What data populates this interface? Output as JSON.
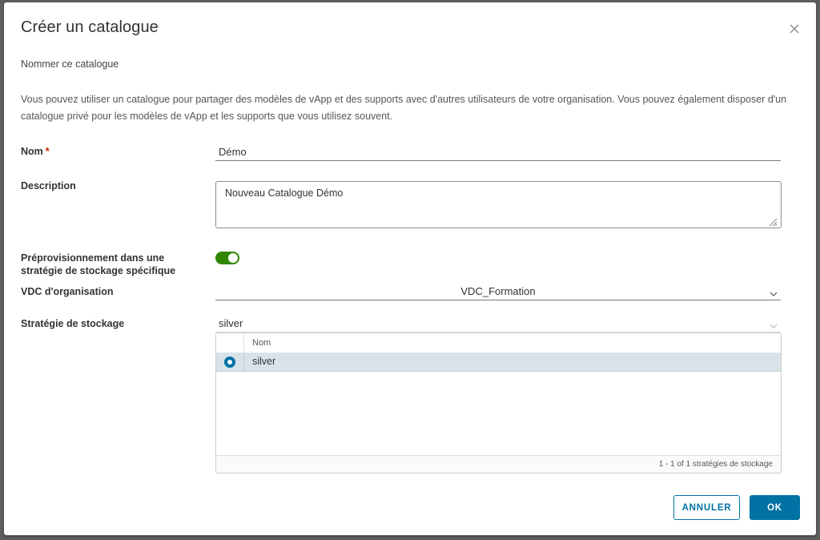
{
  "dialog": {
    "title": "Créer un catalogue",
    "subtitle": "Nommer ce catalogue",
    "intro": "Vous pouvez utiliser un catalogue pour partager des modèles de vApp et des supports avec d'autres utilisateurs de votre organisation. Vous pouvez également disposer d'un catalogue privé pour les modèles de vApp et les supports que vous utilisez souvent."
  },
  "form": {
    "name_label": "Nom",
    "name_required": "*",
    "name_value": "Démo",
    "description_label": "Description",
    "description_value": "Nouveau Catalogue Démo",
    "preprov_label": "Préprovisionnement dans une stratégie de stockage spécifique",
    "preprov_enabled": true,
    "vdc_label": "VDC d'organisation",
    "vdc_value": "VDC_Formation",
    "storage_label": "Stratégie de stockage",
    "storage_value": "silver"
  },
  "grid": {
    "column_header": "Nom",
    "rows": [
      {
        "name": "silver",
        "selected": true
      }
    ],
    "footer": "1 - 1 of 1 stratégies de stockage"
  },
  "buttons": {
    "cancel": "ANNULER",
    "ok": "OK"
  },
  "colors": {
    "primary": "#0072a3",
    "toggle_on": "#318700",
    "required": "#c92100",
    "selected_row": "#d8e3e9"
  }
}
